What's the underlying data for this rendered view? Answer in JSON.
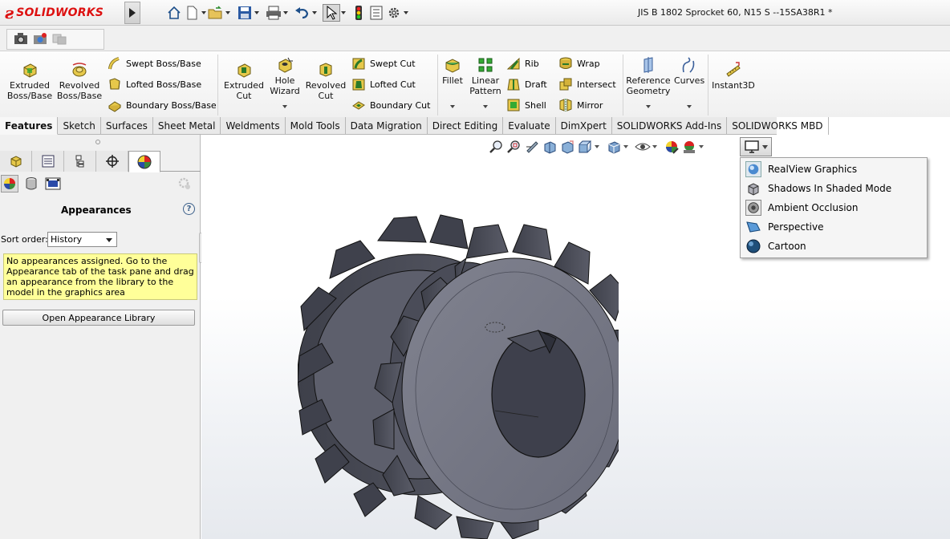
{
  "app": {
    "logo_text": "SOLIDWORKS",
    "document_title": "JIS B 1802 Sprocket 60, N15 S --15SA38R1 *"
  },
  "ribbon": {
    "extruded_boss": "Extruded Boss/Base",
    "revolved_boss": "Revolved Boss/Base",
    "swept_boss": "Swept Boss/Base",
    "lofted_boss": "Lofted Boss/Base",
    "boundary_boss": "Boundary Boss/Base",
    "extruded_cut": "Extruded Cut",
    "hole_wizard": "Hole Wizard",
    "revolved_cut": "Revolved Cut",
    "swept_cut": "Swept Cut",
    "lofted_cut": "Lofted Cut",
    "boundary_cut": "Boundary Cut",
    "fillet": "Fillet",
    "linear_pattern": "Linear Pattern",
    "rib": "Rib",
    "draft": "Draft",
    "shell": "Shell",
    "wrap": "Wrap",
    "intersect": "Intersect",
    "mirror": "Mirror",
    "reference_geometry": "Reference Geometry",
    "curves": "Curves",
    "instant3d": "Instant3D"
  },
  "tabs": [
    "Features",
    "Sketch",
    "Surfaces",
    "Sheet Metal",
    "Weldments",
    "Mold Tools",
    "Data Migration",
    "Direct Editing",
    "Evaluate",
    "DimXpert",
    "SOLIDWORKS Add-Ins",
    "SOLIDWORKS MBD"
  ],
  "panel": {
    "title": "Appearances",
    "help": "?",
    "sort_label": "Sort order:",
    "sort_value": "History",
    "note": "No appearances assigned. Go to the Appearance tab of the task pane and drag an appearance from the library to the model in the graphics area",
    "open_library": "Open Appearance Library"
  },
  "display_menu": {
    "items": [
      "RealView Graphics",
      "Shadows In Shaded Mode",
      "Ambient Occlusion",
      "Perspective",
      "Cartoon"
    ]
  },
  "colors": {
    "brand_red": "#d11111",
    "part_gray": "#6e7080",
    "note_yellow": "#ffff99"
  }
}
